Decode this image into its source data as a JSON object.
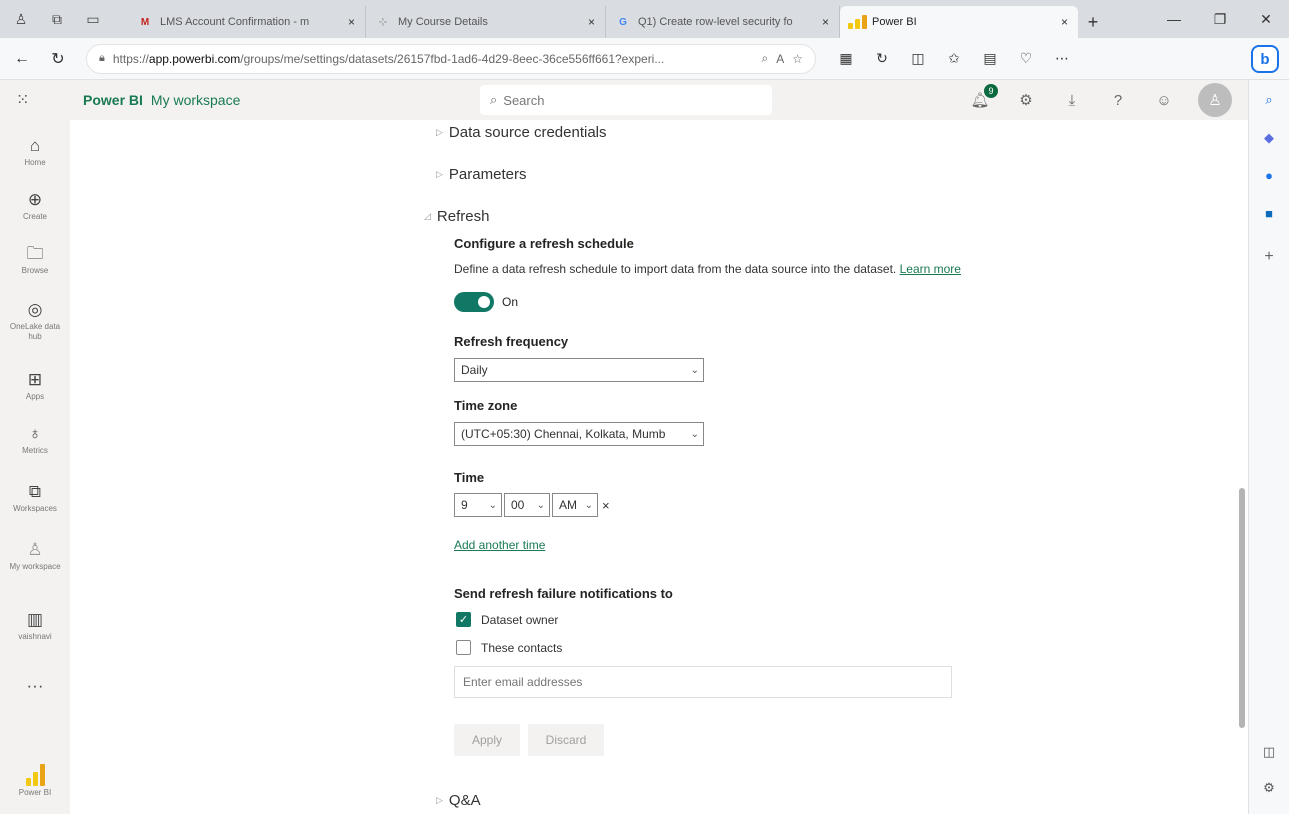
{
  "browser": {
    "tabs": [
      {
        "title": "LMS Account Confirmation - m",
        "icon": "gmail-icon",
        "favicon_text": "M",
        "favicon_color": "#c5221f",
        "close": "×"
      },
      {
        "title": "My Course Details",
        "icon": "course-icon",
        "favicon_text": "⊹",
        "favicon_color": "#999999",
        "close": "×"
      },
      {
        "title": "Q1) Create row-level security fo",
        "icon": "google-icon",
        "favicon_text": "G",
        "favicon_color": "#4285f4",
        "close": "×"
      },
      {
        "title": "Power BI",
        "icon": "powerbi-icon",
        "favicon_text": "",
        "favicon_color": "#f2c811",
        "close": "×"
      }
    ],
    "new_tab": "+",
    "url_prefix": "https://",
    "url_host": "app.powerbi.com",
    "url_path": "/groups/me/settings/datasets/26157fbd-1ad6-4d29-8eec-36ce556ff661?experi..."
  },
  "header": {
    "brand": "Power BI",
    "workspace": "My workspace",
    "search_placeholder": "Search",
    "notification_count": "9"
  },
  "nav": [
    {
      "label": "Home",
      "icon": "home-icon",
      "glyph": "⌂"
    },
    {
      "label": "Create",
      "icon": "create-icon",
      "glyph": "⊕"
    },
    {
      "label": "Browse",
      "icon": "browse-icon",
      "glyph": "🗀"
    },
    {
      "label": "OneLake data hub",
      "icon": "onelake-icon",
      "glyph": "◎"
    },
    {
      "label": "Apps",
      "icon": "apps-icon",
      "glyph": "⊞"
    },
    {
      "label": "Metrics",
      "icon": "metrics-icon",
      "glyph": "♁"
    },
    {
      "label": "Workspaces",
      "icon": "workspaces-icon",
      "glyph": "⧉"
    },
    {
      "label": "My workspace",
      "icon": "my-workspace-icon",
      "glyph": "♙"
    },
    {
      "label": "vaishnavi",
      "icon": "vaishnavi-workspace-icon",
      "glyph": "▥"
    },
    {
      "label": "",
      "icon": "more-icon",
      "glyph": "···"
    },
    {
      "label": "Power BI",
      "icon": "powerbi-logo-icon",
      "glyph": ""
    }
  ],
  "sections": {
    "credentials": "Data source credentials",
    "parameters": "Parameters",
    "refresh": "Refresh",
    "qa": "Q&A"
  },
  "refresh": {
    "configure_title": "Configure a refresh schedule",
    "description": "Define a data refresh schedule to import data from the data source into the dataset.",
    "learn_more": "Learn more",
    "toggle_label": "On",
    "toggle_on": true,
    "frequency_label": "Refresh frequency",
    "frequency_value": "Daily",
    "timezone_label": "Time zone",
    "timezone_value": "(UTC+05:30) Chennai, Kolkata, Mumb",
    "time_label": "Time",
    "time_hour": "9",
    "time_minute": "00",
    "time_ampm": "AM",
    "remove_time": "×",
    "add_time": "Add another time",
    "notify_label": "Send refresh failure notifications to",
    "dataset_owner": "Dataset owner",
    "dataset_owner_checked": true,
    "these_contacts": "These contacts",
    "these_contacts_checked": false,
    "email_placeholder": "Enter email addresses",
    "apply": "Apply",
    "discard": "Discard"
  },
  "colors": {
    "accent": "#117865",
    "brand_text": "#1a7a52"
  }
}
